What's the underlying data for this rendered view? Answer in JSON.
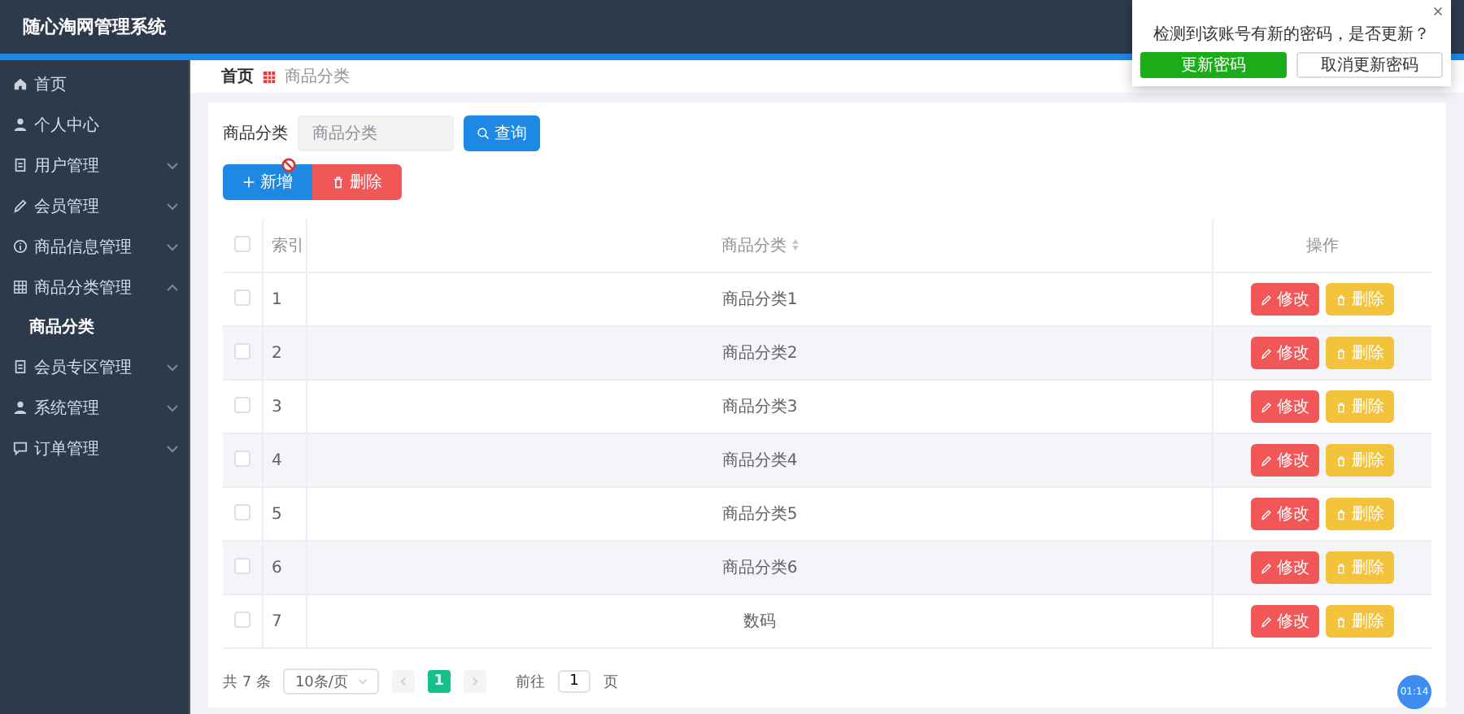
{
  "header": {
    "title": "随心淘网管理系统"
  },
  "sidebar": {
    "items": [
      {
        "label": "首页"
      },
      {
        "label": "个人中心"
      },
      {
        "label": "用户管理",
        "expanded": false
      },
      {
        "label": "会员管理",
        "expanded": false
      },
      {
        "label": "商品信息管理",
        "expanded": false
      },
      {
        "label": "商品分类管理",
        "expanded": true,
        "children": [
          {
            "label": "商品分类",
            "selected": true
          }
        ]
      },
      {
        "label": "会员专区管理",
        "expanded": false
      },
      {
        "label": "系统管理",
        "expanded": false
      },
      {
        "label": "订单管理",
        "expanded": false
      }
    ]
  },
  "breadcrumb": [
    "首页",
    "商品分类"
  ],
  "search": {
    "label": "商品分类",
    "placeholder": "商品分类",
    "button": "查询"
  },
  "actions": {
    "add": "新增",
    "delete": "删除"
  },
  "table": {
    "select_all_checked": false,
    "columns": [
      "索引",
      "商品分类",
      "操作"
    ],
    "rows": [
      {
        "checked": false,
        "index": "1",
        "name": "商品分类1",
        "edit": "修改",
        "delete": "删除"
      },
      {
        "checked": false,
        "index": "2",
        "name": "商品分类2",
        "edit": "修改",
        "delete": "删除"
      },
      {
        "checked": false,
        "index": "3",
        "name": "商品分类3",
        "edit": "修改",
        "delete": "删除"
      },
      {
        "checked": false,
        "index": "4",
        "name": "商品分类4",
        "edit": "修改",
        "delete": "删除"
      },
      {
        "checked": false,
        "index": "5",
        "name": "商品分类5",
        "edit": "修改",
        "delete": "删除"
      },
      {
        "checked": false,
        "index": "6",
        "name": "商品分类6",
        "edit": "修改",
        "delete": "删除"
      },
      {
        "checked": false,
        "index": "7",
        "name": "数码",
        "edit": "修改",
        "delete": "删除"
      }
    ]
  },
  "pagination": {
    "total": "共 7 条",
    "page_size": "10条/页",
    "pages": [
      {
        "label": "1",
        "selected": true
      }
    ],
    "goto_label": "前往",
    "goto_value": "1",
    "goto_suffix": "页"
  },
  "popup": {
    "message": "检测到该账号有新的密码，是否更新？",
    "confirm": "更新密码",
    "cancel": "取消更新密码"
  },
  "timer": "01:14"
}
